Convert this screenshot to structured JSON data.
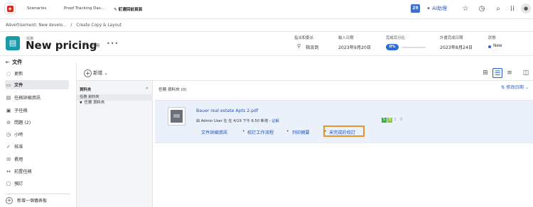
{
  "topbar": {
    "tabs": [
      "Scenarios",
      "Proof Tracking Das...",
      "釘選回前頁面"
    ],
    "badge_count": "29",
    "ai_label": "AI助理"
  },
  "breadcrumb": {
    "items": [
      "Advertisement: New develo...",
      "/",
      "Create Copy & Layout"
    ]
  },
  "header": {
    "type_label": "任務",
    "title": "New pricing",
    "share_label": "共用",
    "fields": {
      "assignee_label": "指派和委派",
      "assignee_value": "指派到",
      "entry_date_label": "輸入日期",
      "entry_date_value": "2023年9月20日",
      "percent_label": "完成百分比",
      "percent_value": "0%",
      "planned_label": "計畫完成日期",
      "planned_value": "2023年8月24日",
      "status_label": "狀態",
      "status_value": "New"
    }
  },
  "sidebar": {
    "section_title": "文件",
    "items": [
      {
        "label": "更新",
        "icon": "speech-bubble-icon"
      },
      {
        "label": "文件",
        "icon": "document-icon"
      },
      {
        "label": "任務詳細資訊",
        "icon": "details-icon"
      },
      {
        "label": "子任務",
        "icon": "subtask-icon"
      },
      {
        "label": "問題 (2)",
        "icon": "issue-icon"
      },
      {
        "label": "小時",
        "icon": "clock-icon"
      },
      {
        "label": "核准",
        "icon": "approval-icon"
      },
      {
        "label": "費用",
        "icon": "expense-icon"
      },
      {
        "label": "前置任務",
        "icon": "predecessor-icon"
      },
      {
        "label": "預訂",
        "icon": "booking-icon"
      }
    ],
    "add_panel_label": "新增一個儀表板"
  },
  "toolbar": {
    "new_label": "新增"
  },
  "folders": {
    "title": "資料夾",
    "sub_label": "任務 資料夾",
    "item_label": "任務 資料夾"
  },
  "list": {
    "header": "任務 資料夾 (0)",
    "sort_label": "修改日期"
  },
  "document": {
    "name": "Bauer real estate Apts 2.pdf",
    "meta_prefix": "由 Admin User 在 在 4/19 下午 6:50 新增 - ",
    "meta_link": "註解",
    "actions": [
      "文件詳細資訊",
      "校訂工作流程",
      "列印摘要",
      "未完成的校訂"
    ],
    "chips": [
      "S",
      "D",
      "C",
      "O"
    ]
  },
  "colors": {
    "accent": "#2f5cc5",
    "task_icon": "#1a9aa8",
    "highlight": "#e8952d",
    "row_bg": "#eaf1fb"
  }
}
